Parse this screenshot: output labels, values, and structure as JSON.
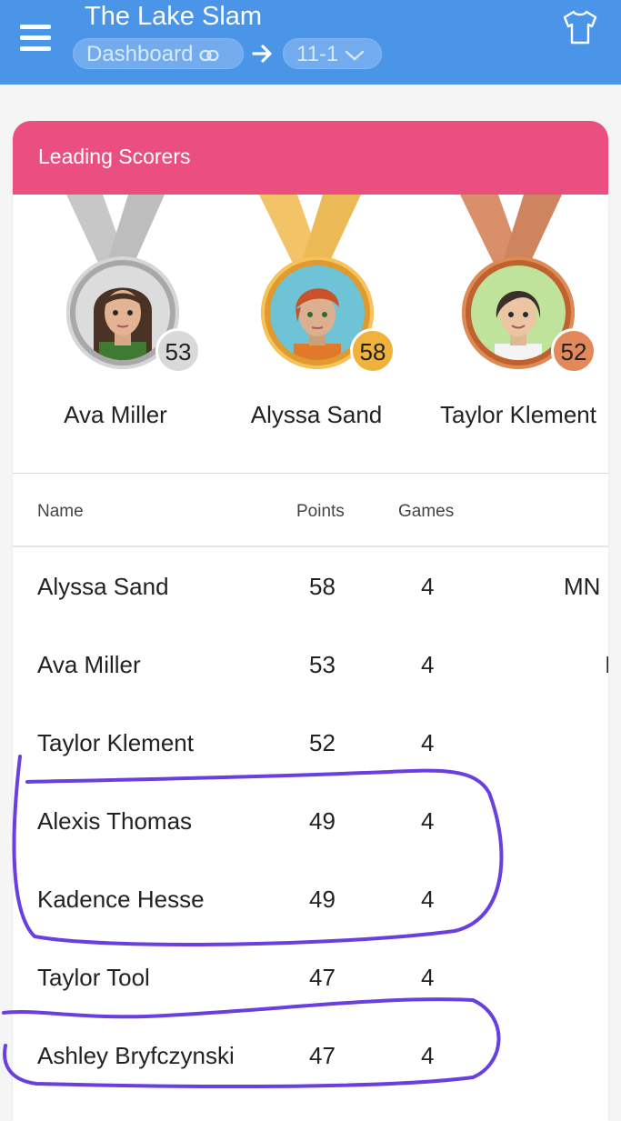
{
  "header": {
    "title": "The Lake Slam",
    "breadcrumb": {
      "dashboard_label": "Dashboard",
      "division_label": "11-1"
    }
  },
  "leaders": {
    "title": "Leading Scorers",
    "medals": [
      {
        "name": "Ava Miller",
        "points": "53",
        "medal": "silver"
      },
      {
        "name": "Alyssa Sand",
        "points": "58",
        "medal": "gold"
      },
      {
        "name": "Taylor Klement",
        "points": "52",
        "medal": "bronze"
      }
    ]
  },
  "table": {
    "headers": {
      "name": "Name",
      "points": "Points",
      "games": "Games"
    },
    "rows": [
      {
        "name": "Alyssa Sand",
        "points": "58",
        "games": "4",
        "extra": "MN"
      },
      {
        "name": "Ava Miller",
        "points": "53",
        "games": "4",
        "extra": "I"
      },
      {
        "name": "Taylor Klement",
        "points": "52",
        "games": "4",
        "extra": ""
      },
      {
        "name": "Alexis Thomas",
        "points": "49",
        "games": "4",
        "extra": ""
      },
      {
        "name": "Kadence Hesse",
        "points": "49",
        "games": "4",
        "extra": ""
      },
      {
        "name": "Taylor Tool",
        "points": "47",
        "games": "4",
        "extra": ""
      },
      {
        "name": "Ashley Bryfczynski",
        "points": "47",
        "games": "4",
        "extra": ""
      }
    ]
  },
  "colors": {
    "header_bg": "#4b95e9",
    "card_header_bg": "#ea4f7f",
    "annotation_ink": "#6a3fe0"
  }
}
